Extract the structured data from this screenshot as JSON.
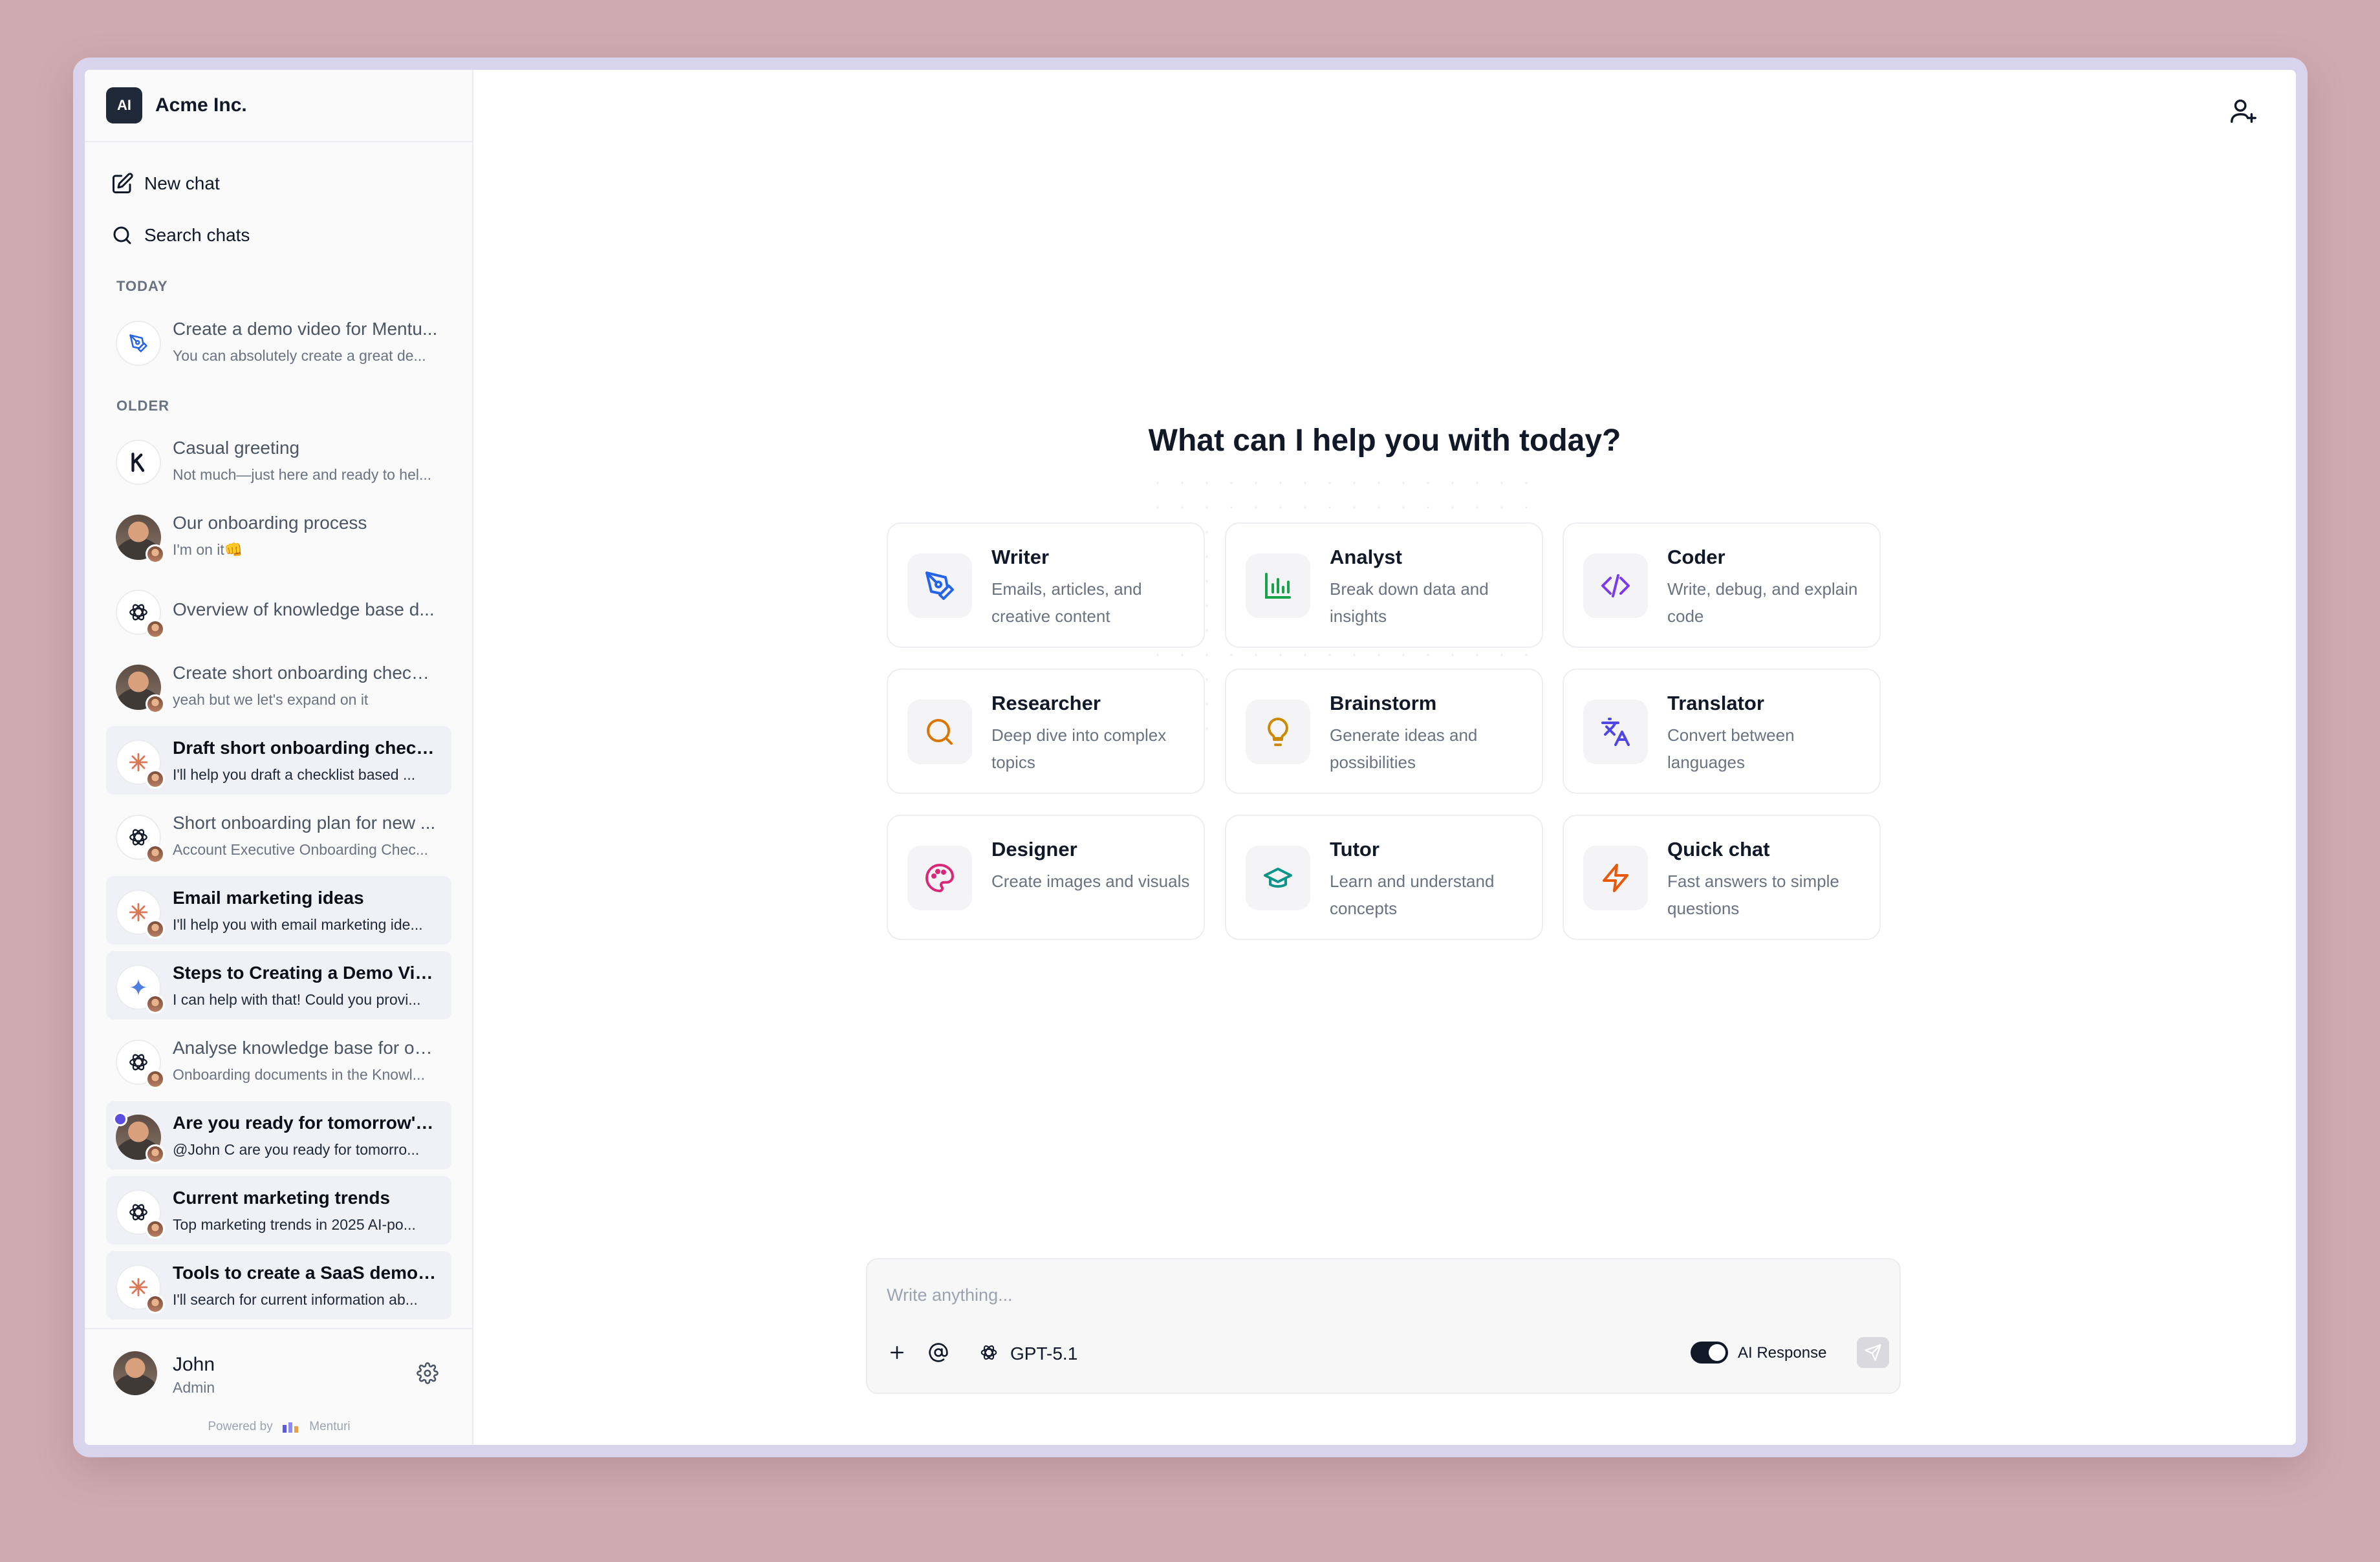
{
  "app": {
    "logo_text": "AI",
    "org_name": "Acme Inc."
  },
  "sidebar": {
    "new_chat_label": "New chat",
    "search_label": "Search chats",
    "today_label": "TODAY",
    "older_label": "OLDER",
    "today_items": [
      {
        "title": "Create a demo video for Mentu...",
        "subtitle": "You can absolutely create a great de...",
        "icon": "pen-tool-icon"
      }
    ],
    "older_items": [
      {
        "title": "Casual greeting",
        "subtitle": "Not much—just here and ready to hel...",
        "icon": "k-logo-icon"
      },
      {
        "title": "Our onboarding process",
        "subtitle": "I'm on it👊",
        "icon": "user-photo"
      },
      {
        "title": "Overview of knowledge base d...",
        "subtitle": "",
        "icon": "openai-icon"
      },
      {
        "title": "Create short onboarding checkl...",
        "subtitle": "yeah but we let's expand on it",
        "icon": "user-photo"
      },
      {
        "title": "Draft short onboarding check...",
        "subtitle": "I'll help you draft a checklist based ...",
        "icon": "claude-icon"
      },
      {
        "title": "Short onboarding plan for new ...",
        "subtitle": "Account Executive Onboarding Chec...",
        "icon": "openai-icon"
      },
      {
        "title": "Email marketing ideas",
        "subtitle": "I'll help you with email marketing ide...",
        "icon": "claude-icon"
      },
      {
        "title": "Steps to Creating a Demo Vid...",
        "subtitle": "I can help with that! Could you provi...",
        "icon": "gemini-icon"
      },
      {
        "title": "Analyse knowledge base for on...",
        "subtitle": "Onboarding documents in the Knowl...",
        "icon": "openai-icon"
      },
      {
        "title": "Are you ready for tomorrow's ...",
        "subtitle": "@John C are you ready for tomorro...",
        "icon": "user-photo"
      },
      {
        "title": "Current marketing trends",
        "subtitle": "Top marketing trends in 2025 AI-po...",
        "icon": "openai-icon"
      },
      {
        "title": "Tools to create a SaaS demo ...",
        "subtitle": "I'll search for current information ab...",
        "icon": "claude-icon"
      }
    ],
    "user": {
      "name": "John",
      "role": "Admin"
    },
    "powered_by": "Powered by",
    "powered_brand": "Menturi"
  },
  "main": {
    "headline": "What can I help you with today?",
    "cards": [
      {
        "title": "Writer",
        "desc": "Emails, articles, and creative content",
        "icon": "pen-tool-icon",
        "color": "#2563eb"
      },
      {
        "title": "Analyst",
        "desc": "Break down data and insights",
        "icon": "bar-chart-icon",
        "color": "#16a34a"
      },
      {
        "title": "Coder",
        "desc": "Write, debug, and explain code",
        "icon": "code-icon",
        "color": "#7c3aed"
      },
      {
        "title": "Researcher",
        "desc": "Deep dive into complex topics",
        "icon": "search-icon",
        "color": "#d97706"
      },
      {
        "title": "Brainstorm",
        "desc": "Generate ideas and possibilities",
        "icon": "lightbulb-icon",
        "color": "#ca8a04"
      },
      {
        "title": "Translator",
        "desc": "Convert between languages",
        "icon": "translate-icon",
        "color": "#4f46e5"
      },
      {
        "title": "Designer",
        "desc": "Create images and visuals",
        "icon": "palette-icon",
        "color": "#db2777"
      },
      {
        "title": "Tutor",
        "desc": "Learn and understand concepts",
        "icon": "graduation-cap-icon",
        "color": "#0d9488"
      },
      {
        "title": "Quick chat",
        "desc": "Fast answers to simple questions",
        "icon": "zap-icon",
        "color": "#ea580c"
      }
    ],
    "composer": {
      "placeholder": "Write anything...",
      "model": "GPT-5.1",
      "toggle_label": "AI Response"
    }
  }
}
